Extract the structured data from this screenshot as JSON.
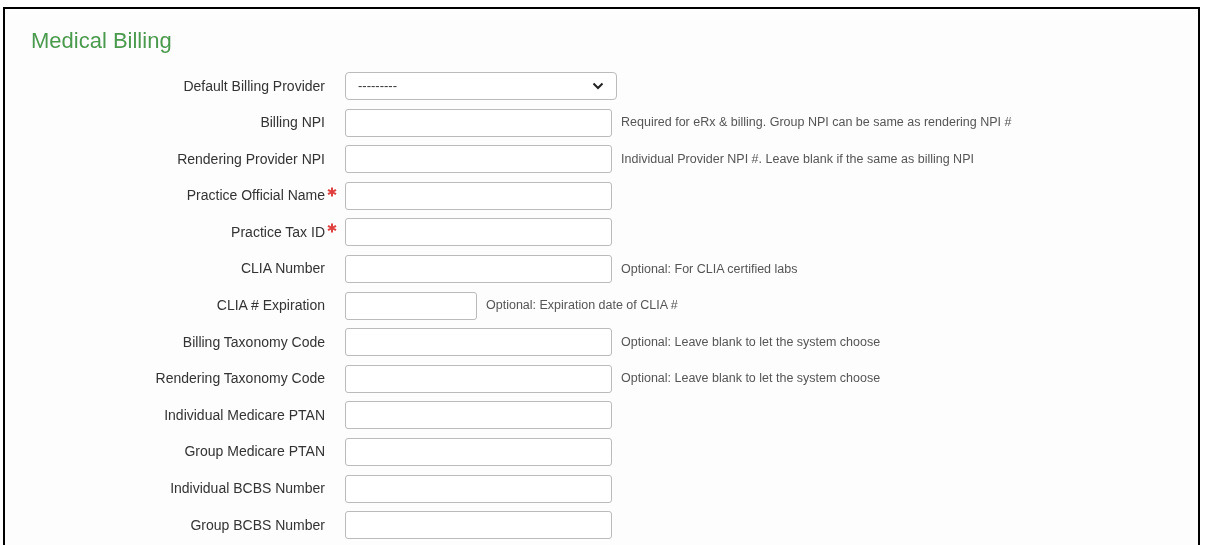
{
  "section": {
    "title": "Medical Billing"
  },
  "fields": [
    {
      "kind": "select",
      "label": "Default Billing Provider",
      "required": false,
      "value": "---------"
    },
    {
      "kind": "text",
      "label": "Billing NPI",
      "required": false,
      "help": "Required for eRx & billing. Group NPI can be same as rendering NPI #"
    },
    {
      "kind": "text",
      "label": "Rendering Provider NPI",
      "required": false,
      "help": "Individual Provider NPI #. Leave blank if the same as billing NPI"
    },
    {
      "kind": "text",
      "label": "Practice Official Name",
      "required": true
    },
    {
      "kind": "text",
      "label": "Practice Tax ID",
      "required": true
    },
    {
      "kind": "text",
      "label": "CLIA Number",
      "required": false,
      "help": "Optional: For CLIA certified labs"
    },
    {
      "kind": "short",
      "label": "CLIA # Expiration",
      "required": false,
      "help": "Optional: Expiration date of CLIA #"
    },
    {
      "kind": "text",
      "label": "Billing Taxonomy Code",
      "required": false,
      "help": "Optional: Leave blank to let the system choose"
    },
    {
      "kind": "text",
      "label": "Rendering Taxonomy Code",
      "required": false,
      "help": "Optional: Leave blank to let the system choose"
    },
    {
      "kind": "text",
      "label": "Individual Medicare PTAN",
      "required": false
    },
    {
      "kind": "text",
      "label": "Group Medicare PTAN",
      "required": false
    },
    {
      "kind": "text",
      "label": "Individual BCBS Number",
      "required": false
    },
    {
      "kind": "text",
      "label": "Group BCBS Number",
      "required": false
    }
  ]
}
